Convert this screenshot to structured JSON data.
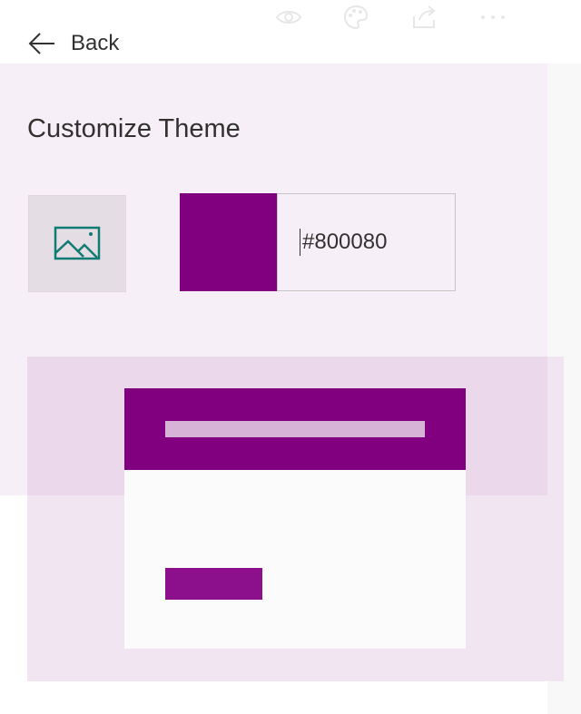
{
  "toolbar": {
    "icons": [
      "eye-icon",
      "palette-icon",
      "share-icon",
      "more-icon"
    ]
  },
  "nav": {
    "back_label": "Back"
  },
  "theme": {
    "title": "Customize Theme",
    "hex_value": "#800080",
    "accent_color": "#800080",
    "panel_background": "#f7eff7"
  },
  "preview": {
    "header_color": "#800080",
    "header_bar_color": "#d8b3d8",
    "button_color": "#8c0f8c"
  }
}
